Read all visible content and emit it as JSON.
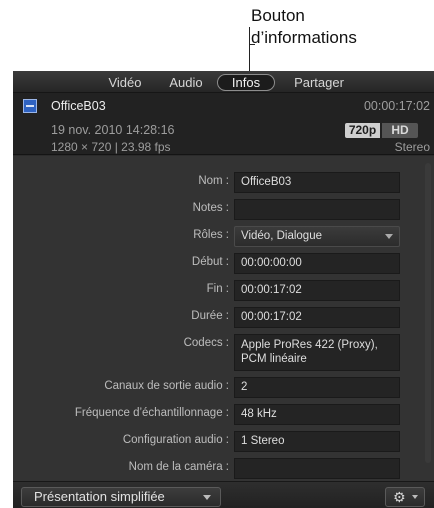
{
  "callout": {
    "line1": "Bouton",
    "line2": "d’informations"
  },
  "tabs": [
    {
      "label": "Vidéo",
      "active": false
    },
    {
      "label": "Audio",
      "active": false
    },
    {
      "label": "Infos",
      "active": true
    },
    {
      "label": "Partager",
      "active": false
    }
  ],
  "header": {
    "icon": "clip-film-icon",
    "clip_name": "OfficeB03",
    "date": "19 nov. 2010 14:28:16",
    "format": "1280 × 720 | 23.98 fps",
    "duration": "00:00:17:02",
    "badge_res": "720p",
    "badge_hd": "HD",
    "audio": "Stereo"
  },
  "fields": [
    {
      "label": "Nom :",
      "value": "OfficeB03"
    },
    {
      "label": "Notes :",
      "value": ""
    },
    {
      "label": "Rôles :",
      "value": "Vidéo, Dialogue"
    },
    {
      "label": "Début :",
      "value": "00:00:00:00"
    },
    {
      "label": "Fin :",
      "value": "00:00:17:02"
    },
    {
      "label": "Durée :",
      "value": "00:00:17:02"
    },
    {
      "label": "Codecs :",
      "value": "Apple ProRes 422 (Proxy), PCM linéaire"
    },
    {
      "label": "Canaux de sortie audio :",
      "value": "2"
    },
    {
      "label": "Fréquence d’échantillonnage :",
      "value": "48 kHz"
    },
    {
      "label": "Configuration audio :",
      "value": "1 Stereo"
    },
    {
      "label": "Nom de la caméra :",
      "value": ""
    }
  ],
  "footer": {
    "view_label": "Présentation simplifiée",
    "action_icon": "gear-icon"
  },
  "colors": {
    "panel": "#2b2b2b",
    "form": "#333333",
    "clip_icon": "#2f63c2"
  }
}
